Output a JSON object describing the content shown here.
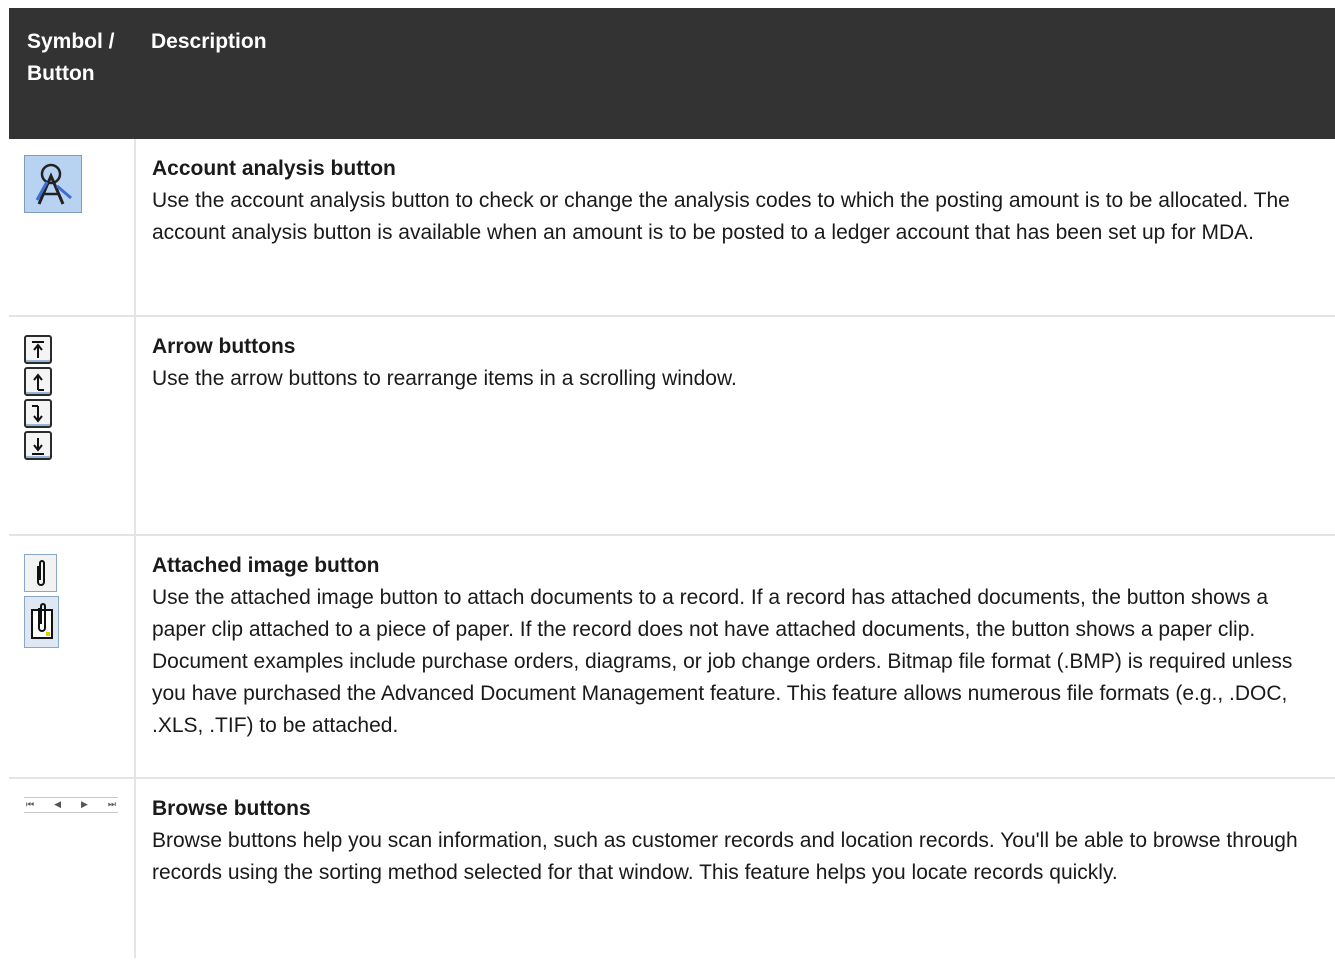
{
  "table": {
    "headers": {
      "symbol": "Symbol / Button",
      "description": "Description"
    },
    "rows": [
      {
        "icon": "account-analysis-icon",
        "title": "Account analysis button",
        "body": "Use the account analysis button to check or change the analysis codes to which the posting amount is to be allocated. The account analysis button is available when an amount is to be posted to a ledger account that has been set up for MDA."
      },
      {
        "icon": "arrow-buttons-icon",
        "title": "Arrow buttons",
        "body": "Use the arrow buttons to rearrange items in a scrolling window."
      },
      {
        "icon": "paper-clip-icon",
        "title": "Attached image button",
        "body": "Use the attached image button to attach documents to a record. If a record has attached documents, the button shows a paper clip attached to a piece of paper. If the record does not have attached documents, the button shows a paper clip. Document examples include purchase orders, diagrams, or job change orders. Bitmap file format (.BMP) is required unless you have purchased the Advanced Document Management feature. This feature allows numerous file formats (e.g., .DOC, .XLS, .TIF) to be attached."
      },
      {
        "icon": "browse-buttons-icon",
        "title": "Browse buttons",
        "body": "Browse buttons help you scan information, such as customer records and location records. You'll be able to browse through records using the sorting method selected for that window. This feature helps you locate records quickly."
      }
    ]
  }
}
